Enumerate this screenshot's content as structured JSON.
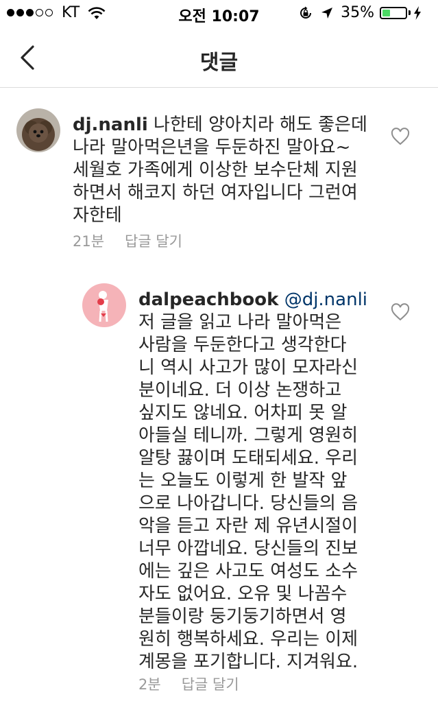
{
  "status_bar": {
    "carrier": "KT",
    "signal_filled": 3,
    "signal_total": 5,
    "time": "오전 10:07",
    "battery_percent": "35%",
    "battery_level": 0.35,
    "icons": [
      "wifi-icon",
      "orientation-lock-icon",
      "location-arrow-icon",
      "battery-icon",
      "charging-icon"
    ]
  },
  "nav": {
    "title": "댓글",
    "back_icon": "chevron-left-icon"
  },
  "comments": [
    {
      "username": "dj.nanli",
      "text": " 나한테 양아치라 해도 좋은데\n나라 말아먹은년을 두둔하진 말아요~\n세월호 가족에게 이상한 보수단체 지원\n하면서 해코지 하던 여자입니다 그런여\n자한테",
      "time": "21분",
      "reply_label": "답글 달기",
      "like_icon": "heart-outline-icon"
    },
    {
      "username": "dalpeachbook",
      "mention": "@dj.nanli",
      "text": "저 글을 읽고 나라 말아먹은\n사람을 두둔한다고 생각한다\n니 역시 사고가 많이 모자라신\n분이네요. 더 이상 논쟁하고\n싶지도 않네요. 어차피 못 알\n아들실 테니까. 그렇게 영원히\n알탕 끓이며 도태되세요. 우리\n는 오늘도 이렇게 한 발작 앞\n으로 나아갑니다. 당신들의 음\n악을 듣고 자란 제 유년시절이\n너무 아깝네요. 당신들의 진보\n에는 깊은 사고도 여성도 소수\n자도 없어요. 오유 및 나꼼수\n분들이랑 둥기둥기하면서 영\n원히 행복하세요. 우리는 이제\n계몽을 포기합니다. 지겨워요.",
      "time": "2분",
      "reply_label": "답글 달기",
      "like_icon": "heart-outline-icon"
    }
  ]
}
